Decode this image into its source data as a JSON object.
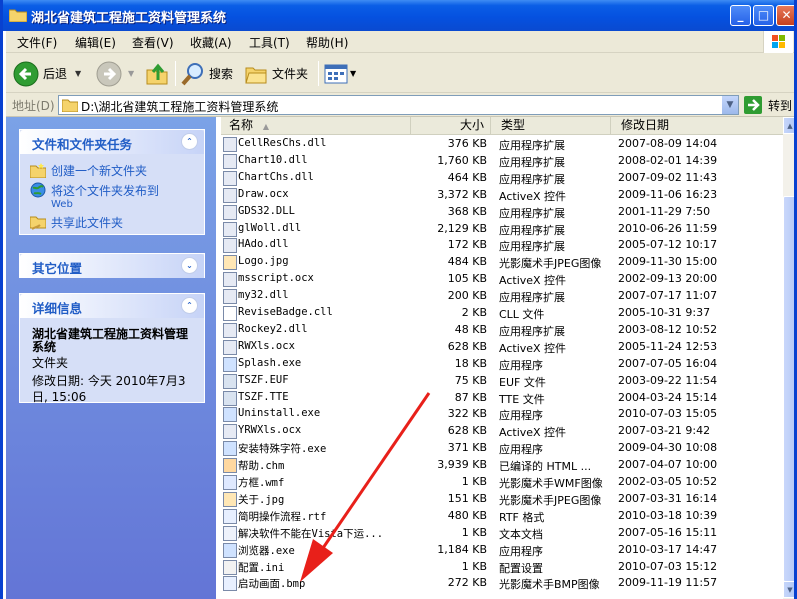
{
  "window": {
    "title": "湖北省建筑工程施工资料管理系统"
  },
  "menu": [
    "文件(F)",
    "编辑(E)",
    "查看(V)",
    "收藏(A)",
    "工具(T)",
    "帮助(H)"
  ],
  "toolbar": {
    "back": "后退",
    "search": "搜索",
    "folders": "文件夹"
  },
  "address": {
    "label": "地址(D)",
    "path": "D:\\湖北省建筑工程施工资料管理系统",
    "go": "转到"
  },
  "tasks_panel": {
    "title": "文件和文件夹任务",
    "items": [
      "创建一个新文件夹",
      "将这个文件夹发布到",
      "Web",
      "共享此文件夹"
    ]
  },
  "other_panel": {
    "title": "其它位置"
  },
  "details_panel": {
    "title": "详细信息",
    "name": "湖北省建筑工程施工资料管理系统",
    "kind": "文件夹",
    "modified_line1": "修改日期: 今天 2010年7月3",
    "modified_line2": "日, 15:06"
  },
  "columns": {
    "name": "名称",
    "size": "大小",
    "type": "类型",
    "date": "修改日期"
  },
  "files": [
    {
      "name": "CellResChs.dll",
      "size": "376 KB",
      "type": "应用程序扩展",
      "date": "2007-08-09 14:04"
    },
    {
      "name": "Chart10.dll",
      "size": "1,760 KB",
      "type": "应用程序扩展",
      "date": "2008-02-01 14:39"
    },
    {
      "name": "ChartChs.dll",
      "size": "464 KB",
      "type": "应用程序扩展",
      "date": "2007-09-02 11:43"
    },
    {
      "name": "Draw.ocx",
      "size": "3,372 KB",
      "type": "ActiveX 控件",
      "date": "2009-11-06 16:23"
    },
    {
      "name": "GDS32.DLL",
      "size": "368 KB",
      "type": "应用程序扩展",
      "date": "2001-11-29 7:50"
    },
    {
      "name": "glWoll.dll",
      "size": "2,129 KB",
      "type": "应用程序扩展",
      "date": "2010-06-26 11:59"
    },
    {
      "name": "HAdo.dll",
      "size": "172 KB",
      "type": "应用程序扩展",
      "date": "2005-07-12 10:17"
    },
    {
      "name": "Logo.jpg",
      "size": "484 KB",
      "type": "光影魔术手JPEG图像",
      "date": "2009-11-30 15:00"
    },
    {
      "name": "msscript.ocx",
      "size": "105 KB",
      "type": "ActiveX 控件",
      "date": "2002-09-13 20:00"
    },
    {
      "name": "my32.dll",
      "size": "200 KB",
      "type": "应用程序扩展",
      "date": "2007-07-17 11:07"
    },
    {
      "name": "ReviseBadge.cll",
      "size": "2 KB",
      "type": "CLL 文件",
      "date": "2005-10-31 9:37"
    },
    {
      "name": "Rockey2.dll",
      "size": "48 KB",
      "type": "应用程序扩展",
      "date": "2003-08-12 10:52"
    },
    {
      "name": "RWXls.ocx",
      "size": "628 KB",
      "type": "ActiveX 控件",
      "date": "2005-11-24 12:53"
    },
    {
      "name": "Splash.exe",
      "size": "18 KB",
      "type": "应用程序",
      "date": "2007-07-05 16:04"
    },
    {
      "name": "TSZF.EUF",
      "size": "75 KB",
      "type": "EUF 文件",
      "date": "2003-09-22 11:54"
    },
    {
      "name": "TSZF.TTE",
      "size": "87 KB",
      "type": "TTE 文件",
      "date": "2004-03-24 15:14"
    },
    {
      "name": "Uninstall.exe",
      "size": "322 KB",
      "type": "应用程序",
      "date": "2010-07-03 15:05"
    },
    {
      "name": "YRWXls.ocx",
      "size": "628 KB",
      "type": "ActiveX 控件",
      "date": "2007-03-21 9:42"
    },
    {
      "name": "安装特殊字符.exe",
      "size": "371 KB",
      "type": "应用程序",
      "date": "2009-04-30 10:08"
    },
    {
      "name": "帮助.chm",
      "size": "3,939 KB",
      "type": "已编译的 HTML ...",
      "date": "2007-04-07 10:00"
    },
    {
      "name": "方框.wmf",
      "size": "1 KB",
      "type": "光影魔术手WMF图像",
      "date": "2002-03-05 10:52"
    },
    {
      "name": "关于.jpg",
      "size": "151 KB",
      "type": "光影魔术手JPEG图像",
      "date": "2007-03-31 16:14"
    },
    {
      "name": "简明操作流程.rtf",
      "size": "480 KB",
      "type": "RTF 格式",
      "date": "2010-03-18 10:39"
    },
    {
      "name": "解决软件不能在Vista下运...",
      "size": "1 KB",
      "type": "文本文档",
      "date": "2007-05-16 15:11"
    },
    {
      "name": "浏览器.exe",
      "size": "1,184 KB",
      "type": "应用程序",
      "date": "2010-03-17 14:47"
    },
    {
      "name": "配置.ini",
      "size": "1 KB",
      "type": "配置设置",
      "date": "2010-07-03 15:12"
    },
    {
      "name": "启动画面.bmp",
      "size": "272 KB",
      "type": "光影魔术手BMP图像",
      "date": "2009-11-19 11:57"
    }
  ],
  "colors": {
    "title_blue": "#0a5ee6",
    "task_blue": "#215dc6",
    "annotation_arrow": "#e8201a"
  }
}
